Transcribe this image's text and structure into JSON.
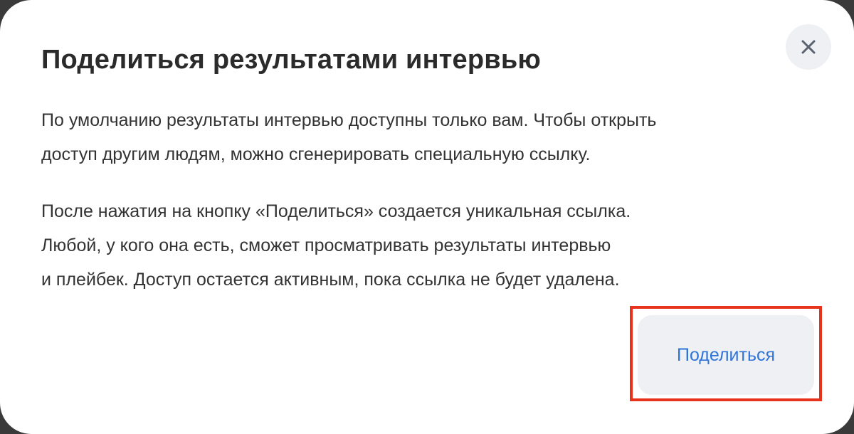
{
  "dialog": {
    "title": "Поделиться результатами интервью",
    "paragraph1": [
      "По умолчанию результаты интервью доступны только вам. Чтобы открыть",
      "доступ другим людям, можно сгенерировать специальную ссылку."
    ],
    "paragraph2": [
      "После нажатия на кнопку «Поделиться» создается уникальная ссылка.",
      "Любой, у кого она есть, сможет просматривать результаты интервью",
      "и плейбек. Доступ остается активным, пока ссылка не будет удалена."
    ],
    "share_button_label": "Поделиться",
    "close_icon": "close-icon"
  },
  "colors": {
    "accent": "#2f74d9",
    "highlight": "#e8331c",
    "button_bg": "#eef0f4"
  }
}
